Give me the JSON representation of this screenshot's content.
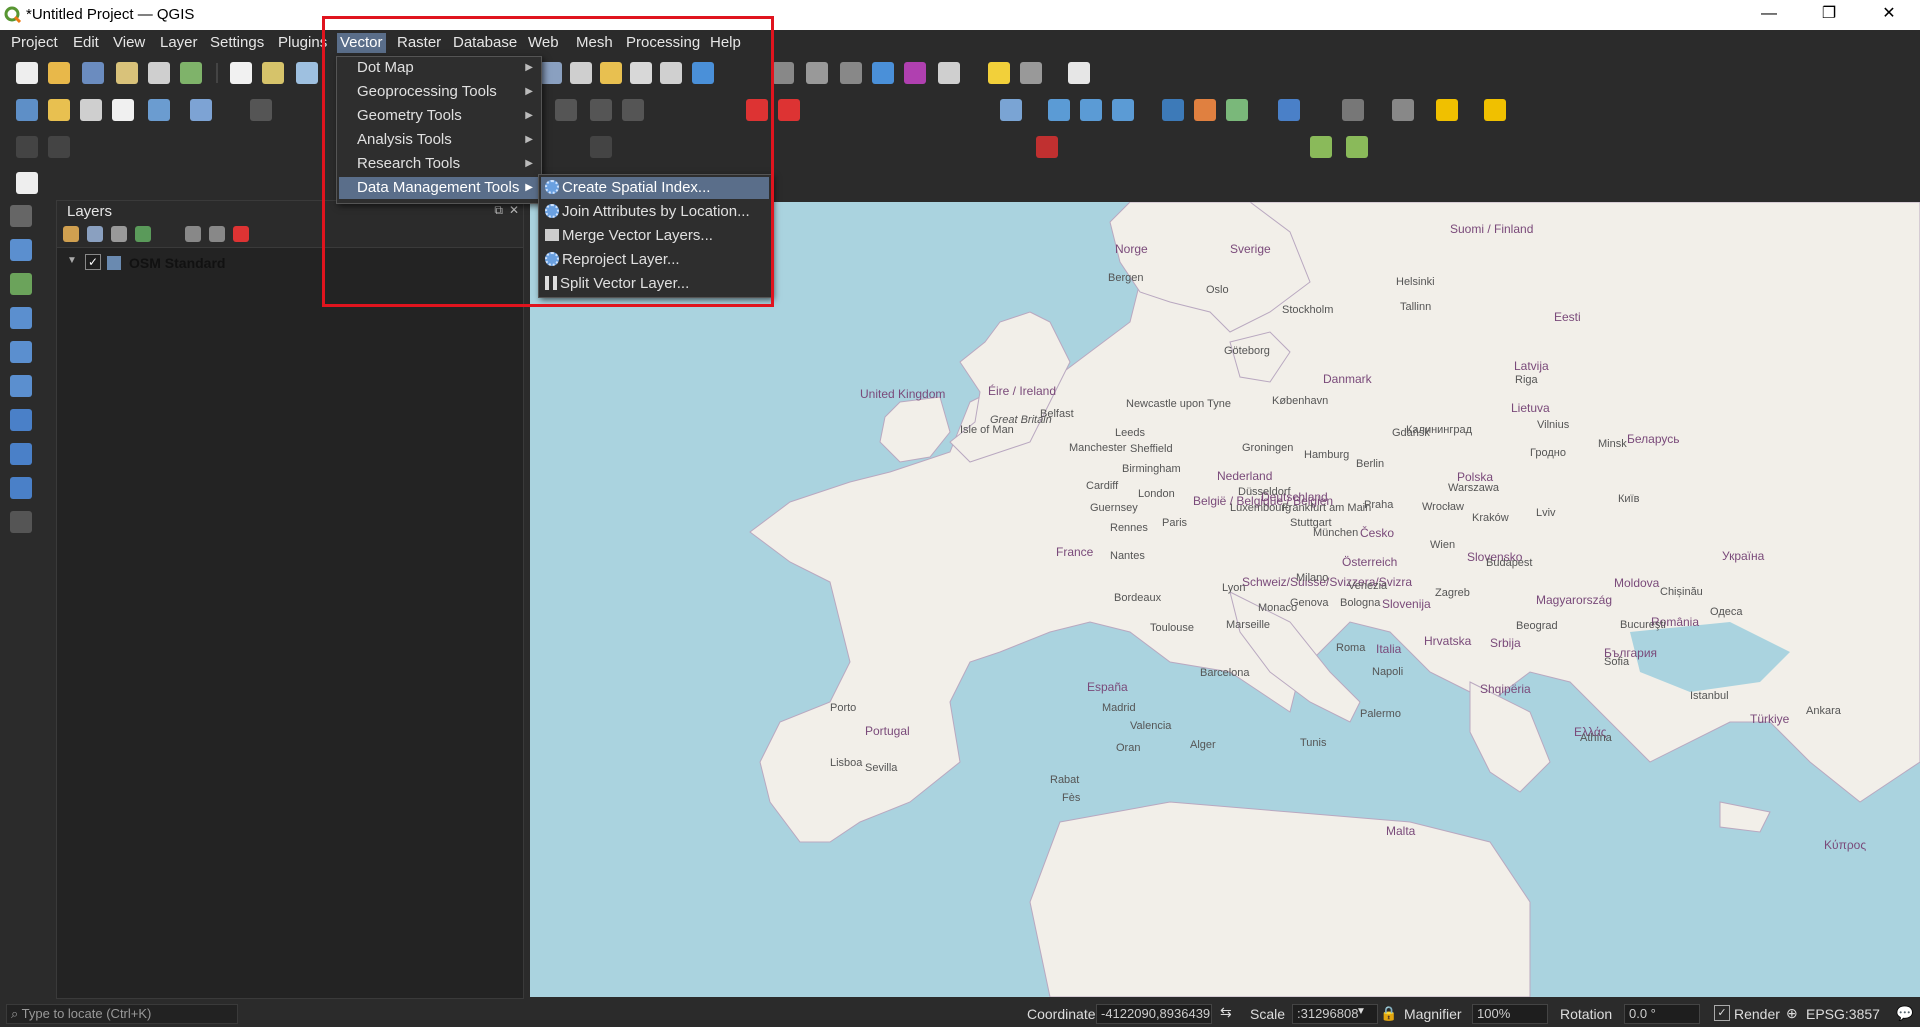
{
  "window": {
    "title": "*Untitled Project — QGIS",
    "controls": [
      "—",
      "❐",
      "✕"
    ]
  },
  "menubar": {
    "items": [
      "Project",
      "Edit",
      "View",
      "Layer",
      "Settings",
      "Plugins",
      "Vector",
      "Raster",
      "Database",
      "Web",
      "Mesh",
      "Processing",
      "Help"
    ],
    "active": "Vector"
  },
  "vector_menu": {
    "items": [
      "Dot Map",
      "Geoprocessing Tools",
      "Geometry Tools",
      "Analysis Tools",
      "Research Tools",
      "Data Management Tools"
    ],
    "highlighted": "Data Management Tools"
  },
  "data_management_submenu": {
    "items": [
      "Create Spatial Index...",
      "Join Attributes by Location...",
      "Merge Vector Layers...",
      "Reproject Layer...",
      "Split Vector Layer..."
    ],
    "highlighted": "Create Spatial Index..."
  },
  "layers_panel": {
    "title": "Layers",
    "layers": [
      {
        "name": "OSM Standard",
        "checked": true
      }
    ]
  },
  "map_labels": {
    "countries": [
      "United Kingdom",
      "Éire / Ireland",
      "France",
      "España",
      "Deutschland",
      "Polska",
      "Italia",
      "Danmark",
      "Latvija",
      "Lietuva",
      "Eesti",
      "Україна",
      "Беларусь",
      "Magyarország",
      "România",
      "Portugal",
      "Nederland",
      "België / Belgique / Belgien",
      "Česko",
      "Slovensko",
      "Österreich",
      "Schweiz/Suisse/Svizzera/Svizra",
      "Slovenija",
      "Hrvatska",
      "Srbija",
      "България",
      "Moldova",
      "Ελλάς",
      "Shqipëria",
      "Türkiye",
      "Sverige",
      "Norge",
      "Suomi / Finland",
      "Malta",
      "Κύπρος"
    ],
    "cities": [
      "Bergen",
      "Oslo",
      "Stockholm",
      "Helsinki",
      "Tallinn",
      "Göteborg",
      "København",
      "Riga",
      "Gdańsk",
      "Калининград",
      "Vilnius",
      "Minsk",
      "Hamburg",
      "Berlin",
      "Warszawa",
      "London",
      "Birmingham",
      "Manchester",
      "Leeds",
      "Sheffield",
      "Belfast",
      "Newcastle upon Tyne",
      "Cardiff",
      "Groningen",
      "Düsseldorf",
      "Frankfurt am Main",
      "Praha",
      "Wrocław",
      "Kraków",
      "Lviv",
      "Київ",
      "Paris",
      "Nantes",
      "Rennes",
      "Lyon",
      "Marseille",
      "Milano",
      "Venezia",
      "Roma",
      "Napoli",
      "Barcelona",
      "Madrid",
      "Valencia",
      "Lisboa",
      "Sevilla",
      "Porto",
      "Wien",
      "Budapest",
      "Beograd",
      "Bucureşti",
      "Sofia",
      "Athína",
      "Istanbul",
      "Ankara",
      "Alger",
      "Tunis",
      "Oran",
      "Rabat",
      "Fès",
      "Palermo",
      "Zagreb",
      "München",
      "Stuttgart",
      "Bologna",
      "Genova",
      "Monaco",
      "Luxembourg",
      "Bordeaux",
      "Toulouse",
      "Great Britain",
      "Isle of Man",
      "Guernsey",
      "Chișinău",
      "Одеса",
      "Гродно"
    ]
  },
  "statusbar": {
    "locate_placeholder": "Type to locate (Ctrl+K)",
    "coordinate_label": "Coordinate",
    "coordinate_value": "-4122090,8936439",
    "scale_label": "Scale",
    "scale_value": ":31296808",
    "magnifier_label": "Magnifier",
    "magnifier_value": "100%",
    "rotation_label": "Rotation",
    "rotation_value": "0.0 °",
    "render_label": "Render",
    "crs": "EPSG:3857"
  },
  "colors": {
    "sea": "#aad3df",
    "land": "#f2efe9",
    "highlight_box": "#e0141e",
    "menu_highlight": "#5a6e8a"
  }
}
